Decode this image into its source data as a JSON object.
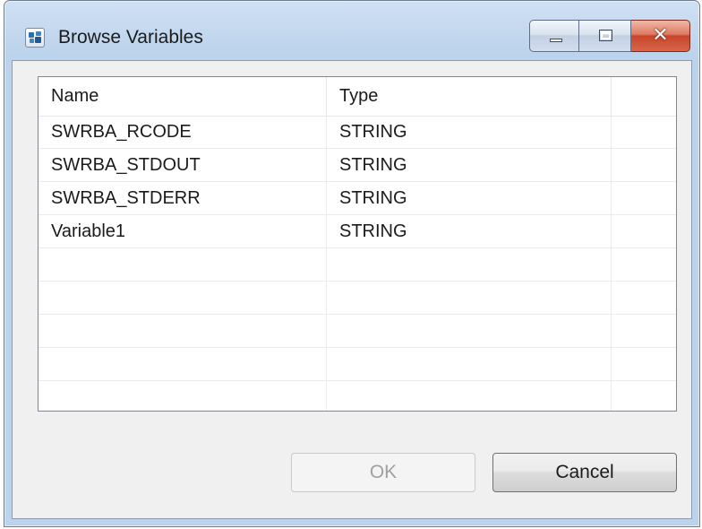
{
  "window": {
    "title": "Browse Variables",
    "icon": "app-icon",
    "caption_buttons": [
      "minimize-icon",
      "maximize-icon",
      "close-icon"
    ]
  },
  "table": {
    "columns": [
      "Name",
      "Type",
      ""
    ],
    "rows": [
      {
        "name": "SWRBA_RCODE",
        "type": "STRING"
      },
      {
        "name": "SWRBA_STDOUT",
        "type": "STRING"
      },
      {
        "name": "SWRBA_STDERR",
        "type": "STRING"
      },
      {
        "name": "Variable1",
        "type": "STRING"
      },
      {
        "name": "",
        "type": ""
      },
      {
        "name": "",
        "type": ""
      },
      {
        "name": "",
        "type": ""
      },
      {
        "name": "",
        "type": ""
      },
      {
        "name": "",
        "type": ""
      }
    ]
  },
  "buttons": {
    "ok_label": "OK",
    "ok_enabled": false,
    "cancel_label": "Cancel"
  },
  "colors": {
    "window_frame": "#bcd3ec",
    "close_button": "#c8452a",
    "client_background": "#f0f0f0"
  }
}
